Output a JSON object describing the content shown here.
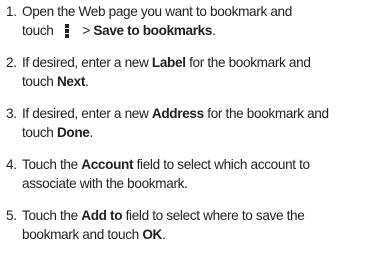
{
  "steps": [
    {
      "number": "1.",
      "line1": "Open the Web page you want to bookmark and",
      "line2_pre": "touch ",
      "icon": "menu-dots-icon",
      "line2_mid": " > ",
      "line2_bold": "Save to bookmarks",
      "line2_post": "."
    },
    {
      "number": "2.",
      "line1_pre": "If desired, enter a new ",
      "line1_bold": "Label",
      "line1_post": " for the bookmark and",
      "line2_pre": "touch ",
      "line2_bold": "Next",
      "line2_post": "."
    },
    {
      "number": "3.",
      "line1_pre": "If desired, enter a new ",
      "line1_bold": "Address",
      "line1_post": " for the bookmark and",
      "line2_pre": "touch ",
      "line2_bold": "Done",
      "line2_post": "."
    },
    {
      "number": "4.",
      "line1_pre": "Touch the ",
      "line1_bold": "Account",
      "line1_post": " field to select which account to",
      "line2": "associate with the bookmark."
    },
    {
      "number": "5.",
      "line1_pre": "Touch the ",
      "line1_bold": "Add to",
      "line1_post": " field to select where to save the",
      "line2_pre": "bookmark and touch ",
      "line2_bold": "OK",
      "line2_post": "."
    }
  ]
}
